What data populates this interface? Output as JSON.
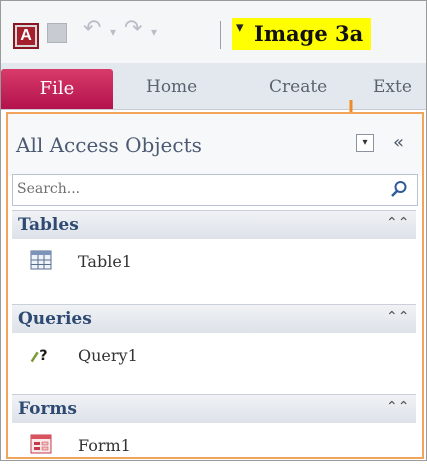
{
  "qat": {
    "app_logo_letter": "A",
    "customize_symbol": "▾"
  },
  "annotation": {
    "label": "Image 3a"
  },
  "ribbon": {
    "tabs": [
      {
        "label": "File"
      },
      {
        "label": "Home"
      },
      {
        "label": "Create"
      },
      {
        "label": "Exte"
      }
    ]
  },
  "nav": {
    "title": "All Access Objects",
    "dropdown_symbol": "▾",
    "collapse_symbol": "«",
    "search": {
      "placeholder": "Search..."
    },
    "groups": [
      {
        "title": "Tables",
        "toggle": "⌃⌃",
        "item": "Table1",
        "icon": "table-icon"
      },
      {
        "title": "Queries",
        "toggle": "⌃⌃",
        "item": "Query1",
        "icon": "query-icon"
      },
      {
        "title": "Forms",
        "toggle": "⌃⌃",
        "item": "Form1",
        "icon": "form-icon"
      }
    ]
  },
  "colors": {
    "file_tab": "#c21a54",
    "nav_border": "#f2a55a",
    "group_title": "#2e4a73",
    "annotation_bg": "#ffff00"
  }
}
